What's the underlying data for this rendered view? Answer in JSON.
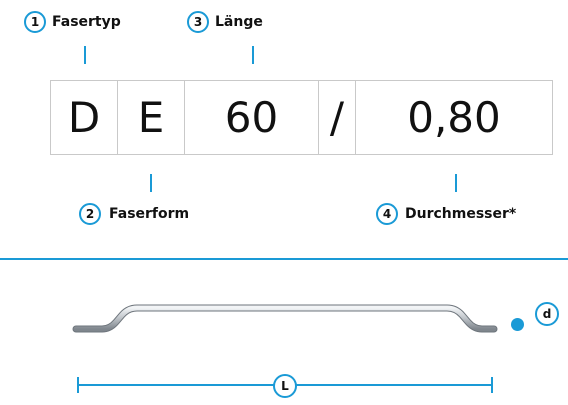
{
  "labels": {
    "fasertyp": {
      "number": "1",
      "text": "Fasertyp"
    },
    "laenge": {
      "number": "3",
      "text": "Länge"
    },
    "faserform": {
      "number": "2",
      "text": "Faserform"
    },
    "durchmesser": {
      "number": "4",
      "text": "Durchmesser*"
    }
  },
  "code": {
    "type": "D",
    "form": "E",
    "length": "60",
    "separator": "/",
    "diameter": "0,80"
  },
  "dimensions": {
    "length_symbol": "L",
    "diameter_symbol": "d"
  },
  "colors": {
    "accent": "#1a9ad6",
    "text": "#111111",
    "box_border": "#c9c9c9"
  }
}
